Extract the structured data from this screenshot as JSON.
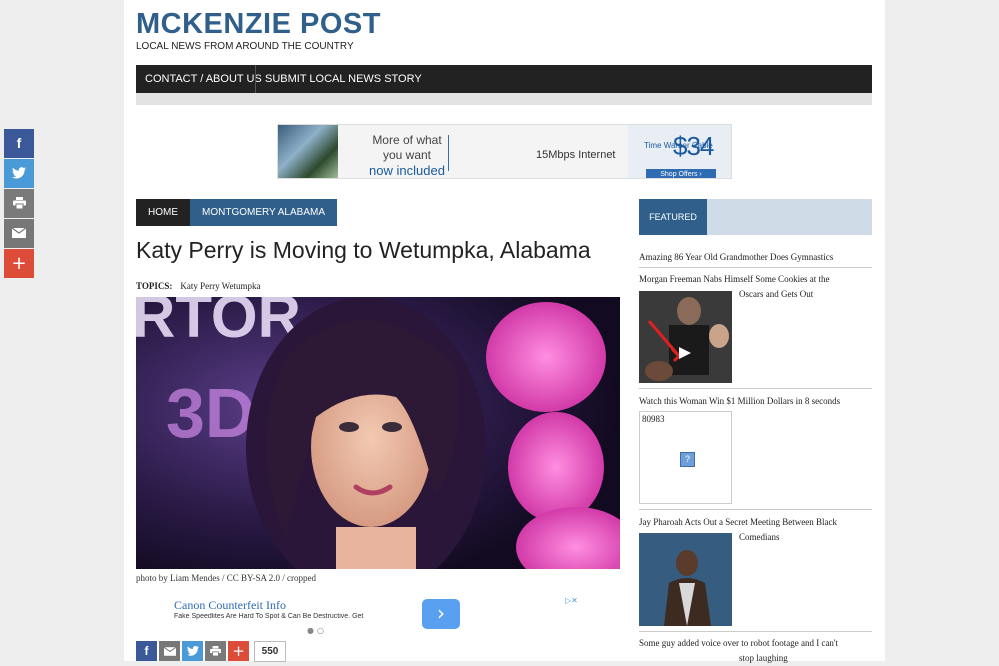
{
  "site": {
    "title": "MCKENZIE POST",
    "tagline": "LOCAL NEWS FROM AROUND THE COUNTRY"
  },
  "nav": {
    "items": [
      {
        "label": "CONTACT / ABOUT US"
      },
      {
        "label": "SUBMIT LOCAL NEWS STORY"
      }
    ]
  },
  "top_ad": {
    "line1": "More of what",
    "line2": "you want",
    "line3": "now included",
    "speed": "15Mbps Internet",
    "brand": "Time Warner Cable",
    "price": "$34",
    "shop": "Shop Offers ›"
  },
  "breadcrumb": {
    "home": "HOME",
    "category": "MONTGOMERY ALABAMA"
  },
  "article": {
    "headline": "Katy Perry is Moving to Wetumpka, Alabama",
    "topics_label": "TOPICS:",
    "topics_value": "Katy Perry Wetumpka",
    "caption": "photo by Liam Mendes / CC BY-SA 2.0 / cropped"
  },
  "native_ad": {
    "title": "Canon Counterfeit Info",
    "subtitle": "Fake Speedlites Are Hard To Spot & Can Be Destructive. Get Informed",
    "button": "›",
    "adchoices": "▷✕"
  },
  "share_bottom": {
    "count": "550"
  },
  "sidebar": {
    "heading": "FEATURED",
    "items": [
      {
        "title": "Amazing 86 Year Old Grandmother Does Gymnastics"
      },
      {
        "title": "Morgan Freeman Nabs Himself Some Cookies at the",
        "title_cont": "Oscars and Gets Out"
      },
      {
        "title": "Watch this Woman Win $1 Million Dollars in 8 seconds",
        "thumb_text": "80983",
        "thumb_icon": "?"
      },
      {
        "title": "Jay Pharoah Acts Out a Secret Meeting Between Black",
        "title_cont": "Comedians"
      },
      {
        "title": "Some guy added voice over to robot footage and I can't",
        "title_cont": "stop laughing"
      }
    ]
  },
  "colors": {
    "brand_blue": "#2f5f8a",
    "facebook": "#3b5998",
    "twitter": "#4a9ad8",
    "print": "#7a7a7a",
    "email": "#777777",
    "plus": "#dd4b39"
  },
  "share_side_icons": [
    "facebook-icon",
    "twitter-icon",
    "print-icon",
    "email-icon",
    "plus-icon"
  ]
}
